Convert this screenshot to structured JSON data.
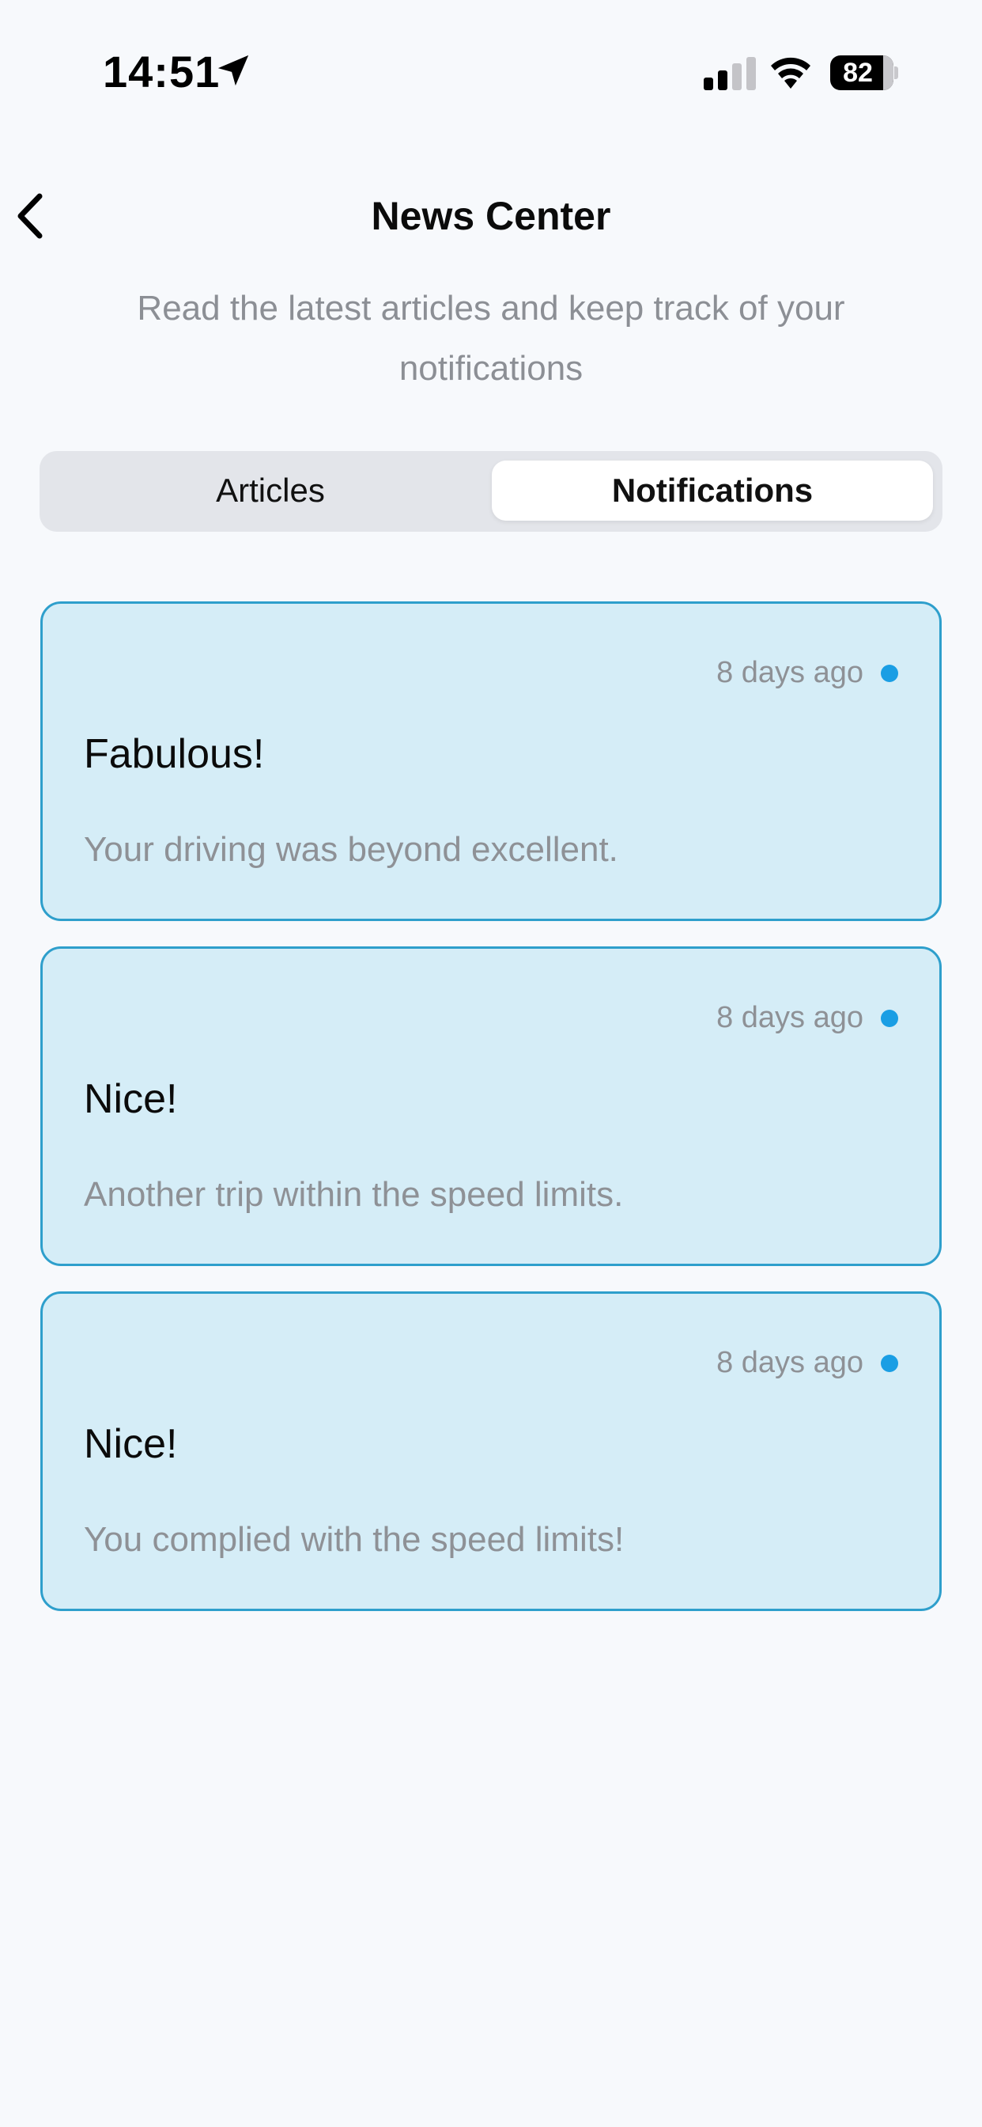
{
  "status_bar": {
    "time": "14:51",
    "battery": "82",
    "icons": [
      "location-arrow-icon",
      "cellular-signal-icon",
      "wifi-icon",
      "battery-icon"
    ]
  },
  "header": {
    "back_icon": "chevron-left-icon",
    "title": "News Center",
    "subtitle": "Read the latest articles and keep track of your notifications"
  },
  "tabs": [
    {
      "label": "Articles",
      "selected": false
    },
    {
      "label": "Notifications",
      "selected": true
    }
  ],
  "notifications": [
    {
      "time": "8 days ago",
      "unread": true,
      "title": "Fabulous!",
      "body": "Your driving was beyond excellent."
    },
    {
      "time": "8 days ago",
      "unread": true,
      "title": "Nice!",
      "body": "Another trip within the speed limits."
    },
    {
      "time": "8 days ago",
      "unread": true,
      "title": "Nice!",
      "body": "You complied with the speed limits!"
    }
  ],
  "colors": {
    "background": "#f7f9fc",
    "card_background": "#d5edf7",
    "card_border": "#2e9fcc",
    "unread_dot": "#1a9ee4",
    "muted_text": "#8e9196"
  }
}
